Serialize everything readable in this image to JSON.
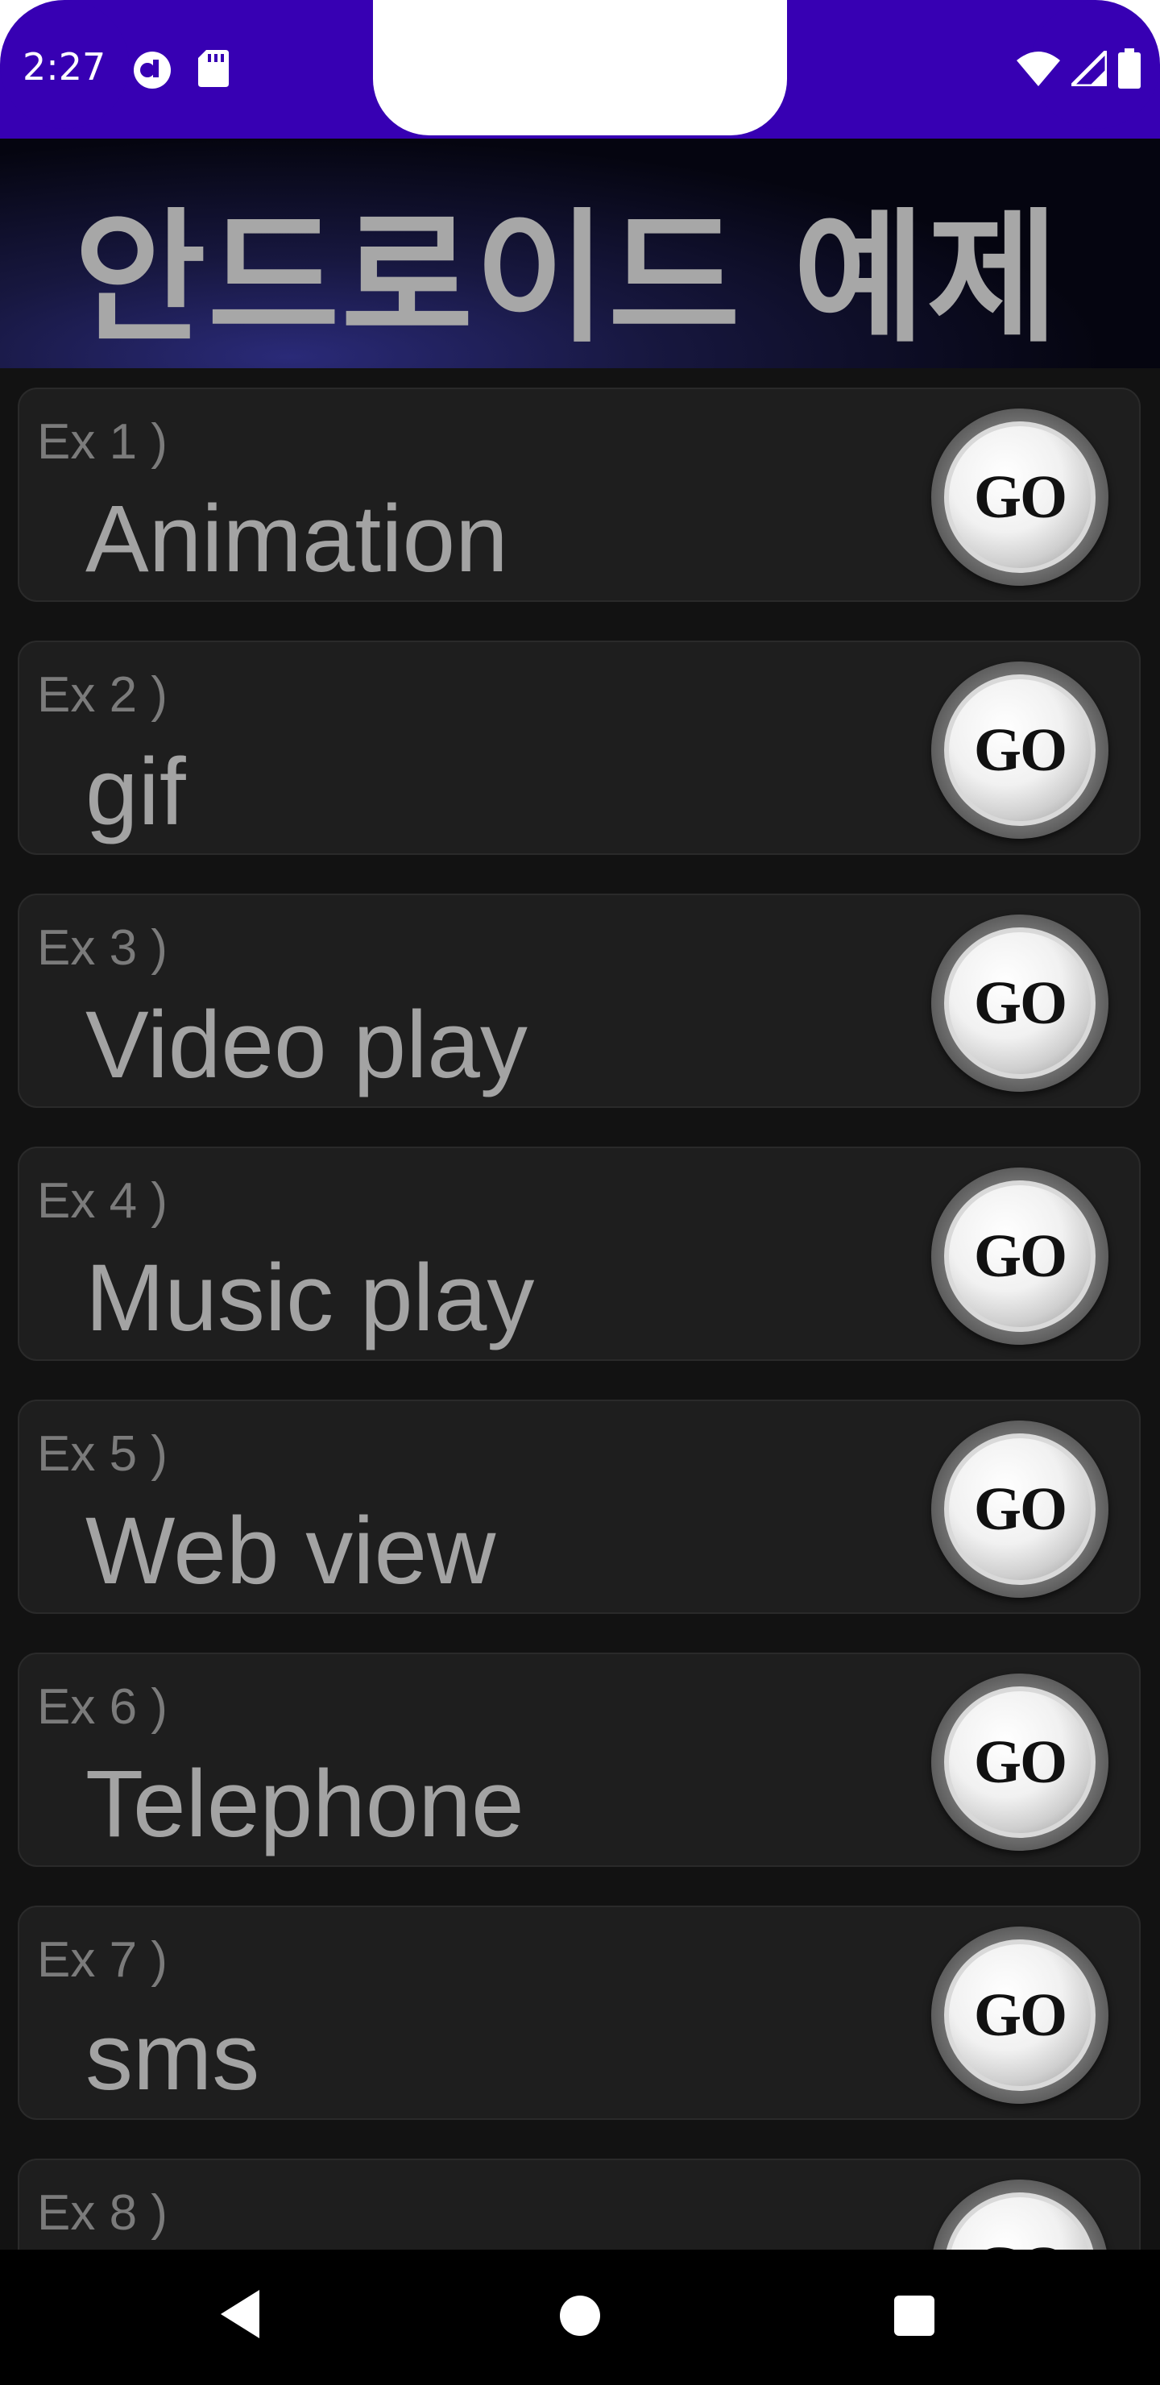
{
  "status_bar": {
    "time": "2:27",
    "icons_left": [
      "tiktok-icon",
      "sd-card-icon"
    ],
    "icons_right": [
      "wifi-icon",
      "signal-icon",
      "battery-icon"
    ],
    "color": "#3700b3"
  },
  "header": {
    "title": "안드로이드 예제"
  },
  "examples": [
    {
      "ex": "Ex 1 )",
      "title": "Animation",
      "button": "GO"
    },
    {
      "ex": "Ex 2 )",
      "title": "gif",
      "button": "GO"
    },
    {
      "ex": "Ex 3 )",
      "title": "Video play",
      "button": "GO"
    },
    {
      "ex": "Ex 4 )",
      "title": "Music play",
      "button": "GO"
    },
    {
      "ex": "Ex 5 )",
      "title": "Web view",
      "button": "GO"
    },
    {
      "ex": "Ex 6 )",
      "title": "Telephone",
      "button": "GO"
    },
    {
      "ex": "Ex 7 )",
      "title": "sms",
      "button": "GO"
    },
    {
      "ex": "Ex 8 )",
      "title": "",
      "button": "GO"
    }
  ],
  "nav_bar": {
    "buttons": [
      "back-icon",
      "home-icon",
      "recents-icon"
    ]
  }
}
